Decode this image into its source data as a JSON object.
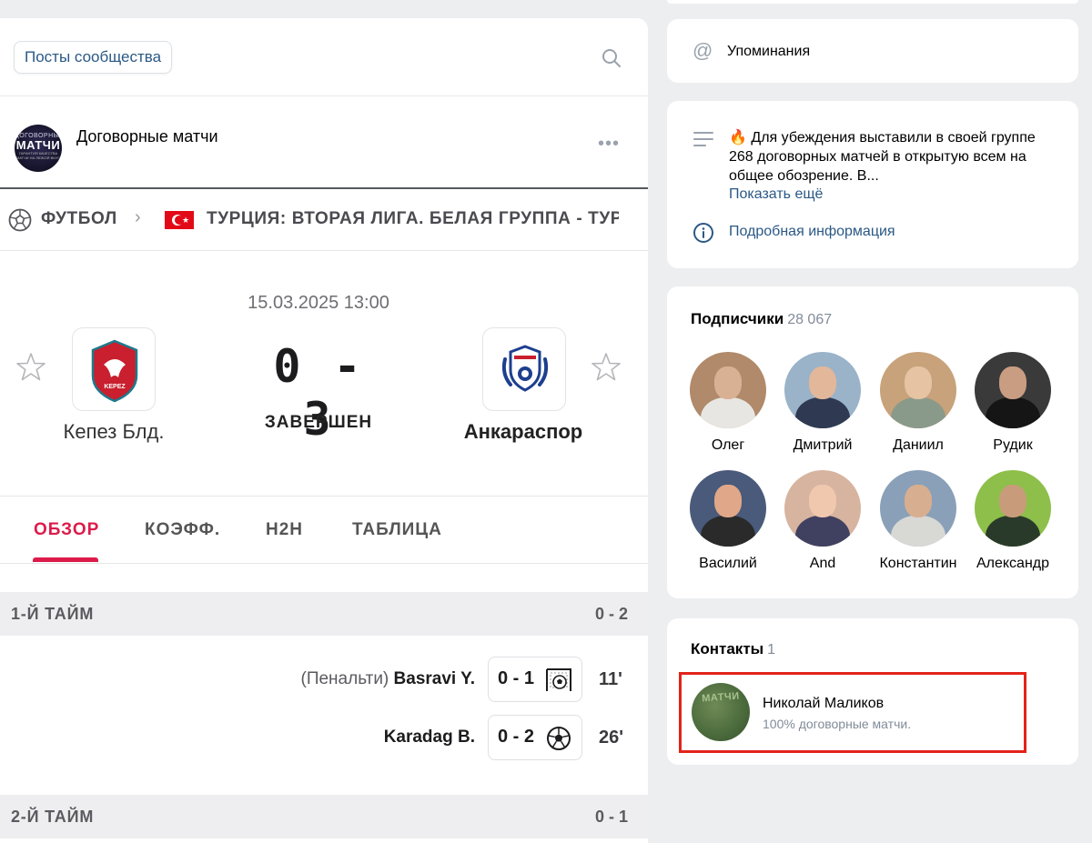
{
  "posts_bar": {
    "button_label": "Посты сообщества"
  },
  "post": {
    "group_name": "Договорные матчи",
    "avatar_text_top": "ДОГОВОРНЫЕ",
    "avatar_text_main": "МАТЧИ",
    "avatar_text_sub": "ГАРАНТИЯ КАЧЕСТВА МАТЧИ НА ЛЮБОЙ ВКУС"
  },
  "breadcrumbs": {
    "sport": "ФУТБОЛ",
    "league": "ТУРЦИЯ: ВТОРАЯ ЛИГА. БЕЛАЯ ГРУППА - ТУР"
  },
  "match": {
    "datetime": "15.03.2025 13:00",
    "home_team": "Кепез Блд.",
    "away_team": "Анкараспор",
    "score": "0 - 3",
    "status": "ЗАВЕРШЕН",
    "home_logo_text": "KEPEZ"
  },
  "tabs": [
    "ОБЗОР",
    "КОЭФФ.",
    "H2H",
    "ТАБЛИЦА"
  ],
  "halves": [
    {
      "label": "1-Й ТАЙМ",
      "score": "0 - 2"
    },
    {
      "label": "2-Й ТАЙМ",
      "score": "0 - 1"
    }
  ],
  "events": [
    {
      "note": "(Пенальти)",
      "player": "Basravi Y.",
      "score": "0 - 1",
      "minute": "11'",
      "icon": "penalty-goal-icon"
    },
    {
      "note": "",
      "player": "Karadag B.",
      "score": "0 - 2",
      "minute": "26'",
      "icon": "goal-ball-icon"
    }
  ],
  "mentions": {
    "label": "Упоминания"
  },
  "about": {
    "text": "🔥 Для убеждения выставили в своей группе 268 договорных матчей в открытую всем на общее обозрение. В...",
    "show_more": "Показать ещё",
    "more_info": "Подробная информация"
  },
  "subscribers": {
    "title": "Подписчики",
    "count": "28 067",
    "people": [
      {
        "name": "Олег",
        "bg": "#b08a6a",
        "face": "#d8b093",
        "body": "#e8e6e2"
      },
      {
        "name": "Дмитрий",
        "bg": "#9ab3c9",
        "face": "#e2b79a",
        "body": "#2f3a52"
      },
      {
        "name": "Даниил",
        "bg": "#c7a27a",
        "face": "#e5c3a3",
        "body": "#8a9a8a"
      },
      {
        "name": "Рудик",
        "bg": "#3a3a3a",
        "face": "#c99d82",
        "body": "#151515"
      },
      {
        "name": "Василий",
        "bg": "#4a5a7a",
        "face": "#e0a888",
        "body": "#2a2a2a"
      },
      {
        "name": "And",
        "bg": "#d7b4a0",
        "face": "#f0c8ae",
        "body": "#404060"
      },
      {
        "name": "Константин",
        "bg": "#8aa0b8",
        "face": "#d8ae90",
        "body": "#d8d8d4"
      },
      {
        "name": "Александр",
        "bg": "#8dbf4a",
        "face": "#c89c7a",
        "body": "#2a3a2a"
      }
    ]
  },
  "contacts": {
    "title": "Контакты",
    "count": "1",
    "name": "Николай Маликов",
    "desc": "100% договорные матчи.",
    "avatar_text": "МАТЧИ"
  },
  "colors": {
    "accent_red": "#dc1b4a",
    "link_blue": "#2a5885",
    "highlight_frame": "#e3231a"
  }
}
